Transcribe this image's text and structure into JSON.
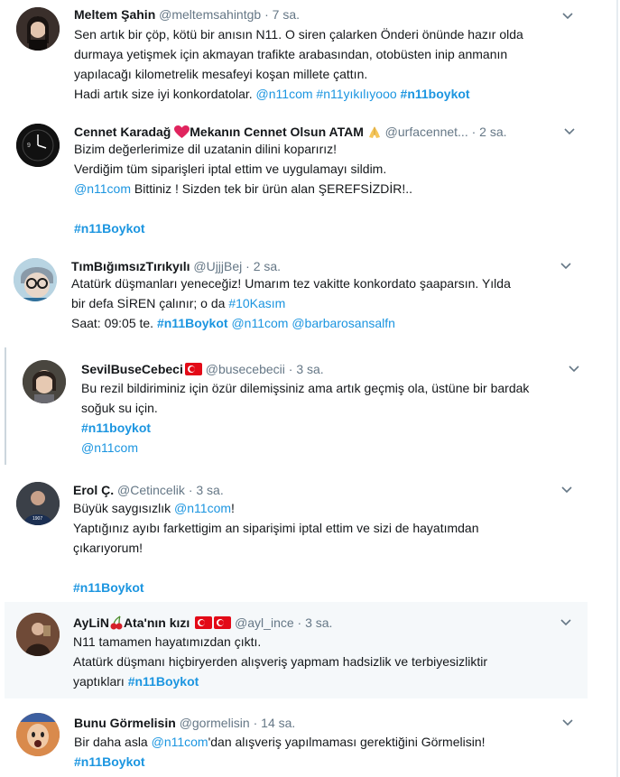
{
  "tweets": [
    {
      "name": "Meltem Şahin",
      "handle": "@meltemsahintgb",
      "dot": "·",
      "time": "7 sa.",
      "lines": [
        "Sen artık bir çöp, kötü bir anısın N11. O siren çalarken Önderi önünde hazır olda",
        "durmaya yetişmek için akmayan trafikte arabasından, otobüsten inip anmanın",
        "yapılacağı kilometrelik mesafeyi koşan millete çattın."
      ],
      "last_text": "Hadi artık size iyi konkordatolar.",
      "last_links": [
        "@n11com",
        "#n11yıkılıyooo"
      ],
      "last_hash": "#n11boykot"
    },
    {
      "name": "Cennet Karadağ",
      "name_rest": "Mekanın Cennet Olsun ATAM",
      "handle": "@urfacennet...",
      "dot": "·",
      "time": "2 sa.",
      "line1": "Bizim değerlerimize dil uzatanin dilini koparırız!",
      "line2": "Verdiğim tüm siparişleri iptal ettim ve uygulamayı sildim.",
      "line3_link": "@n11com",
      "line3_text": "Bittiniz ! Sizden tek bir ürün alan ŞEREFSİZDİR!..",
      "hashtag": "#n11Boykot"
    },
    {
      "name": "TımBığımsızTırıkyılı",
      "handle": "@UjjjBej",
      "dot": "·",
      "time": "2 sa.",
      "line1": "Atatürk düşmanları yeneceğiz!  Umarım tez vakitte konkordato şaaparsın. Yılda",
      "line2_text": "bir defa SİREN çalınır; o da",
      "line2_link": "#10Kasım",
      "line3_text": "Saat: 09:05 te.",
      "line3_hash": "#n11Boykot",
      "line3_links": [
        "@n11com",
        "@barbarosansalfn"
      ]
    },
    {
      "name": "SevilBuseCebeci",
      "handle": "@busecebecii",
      "dot": "·",
      "time": "3 sa.",
      "line1": "Bu rezil bildiriminiz için özür dilemişsiniz ama artık geçmiş ola, üstüne bir bardak",
      "line2": "soğuk su için.",
      "hashtag": "#n11boykot",
      "mention": "@n11com"
    },
    {
      "name": "Erol Ç.",
      "handle": "@Cetincelik",
      "dot": "·",
      "time": "3 sa.",
      "line1_text": "Büyük saygısızlık",
      "line1_link": "@n11com",
      "line1_end": "!",
      "line2": "Yaptığınız ayıbı farkettigim an siparişimi iptal ettim ve sizi de hayatımdan",
      "line3": "çıkarıyorum!",
      "hashtag": "#n11Boykot"
    },
    {
      "name": "AyLiN",
      "name_rest": "Ata'nın kızı",
      "handle": "@ayl_ince",
      "dot": "·",
      "time": "3 sa.",
      "line1": "N11 tamamen hayatımızdan çıktı.",
      "line2": "Atatürk düşmanı hiçbiryerden alışveriş yapmam hadsizlik ve terbiyesizliktir",
      "line3_text": "yaptıkları",
      "line3_hash": "#n11Boykot"
    },
    {
      "name": "Bunu Görmelisin",
      "handle": "@gormelisin",
      "dot": "·",
      "time": "14 sa.",
      "line1_text": "Bir daha asla",
      "line1_link": "@n11com",
      "line1_end": "'dan alışveriş yapılmaması gerektiğini Görmelisin!",
      "hashtag": "#n11Boykot"
    }
  ],
  "colors": {
    "link": "#1b95e0",
    "meta": "#657786",
    "text": "#14171a"
  },
  "icons": [
    "chevron-down-icon",
    "turkey-flag-icon",
    "heart-icon",
    "praying-hands-icon",
    "cherries-icon"
  ]
}
